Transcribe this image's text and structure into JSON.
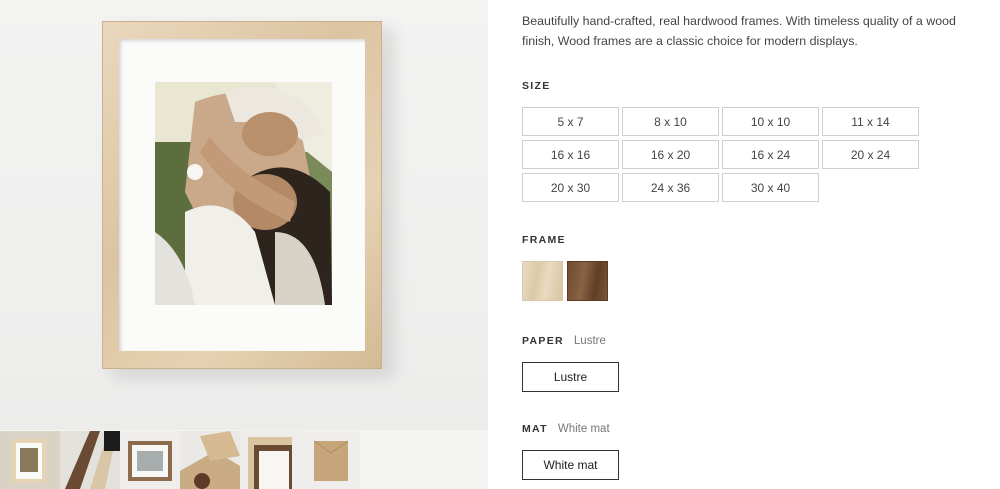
{
  "product": {
    "description": "Beautifully hand-crafted, real hardwood frames. With timeless quality of a wood finish, Wood frames are a classic choice for modern displays."
  },
  "size": {
    "label": "SIZE",
    "options": [
      "5 x 7",
      "8 x 10",
      "10 x 10",
      "11 x 14",
      "16 x 16",
      "16 x 20",
      "16 x 24",
      "20 x 24",
      "20 x 30",
      "24 x 36",
      "30 x 40"
    ]
  },
  "frame": {
    "label": "FRAME",
    "swatches": [
      {
        "name": "light-wood",
        "color": "#e2cfb1"
      },
      {
        "name": "dark-wood",
        "color": "#724d31"
      }
    ]
  },
  "paper": {
    "label": "PAPER",
    "selected": "Lustre",
    "options": [
      "Lustre"
    ]
  },
  "mat": {
    "label": "MAT",
    "selected": "White mat",
    "options": [
      "White mat"
    ]
  },
  "gallery": {
    "thumbnail_count": 6
  }
}
